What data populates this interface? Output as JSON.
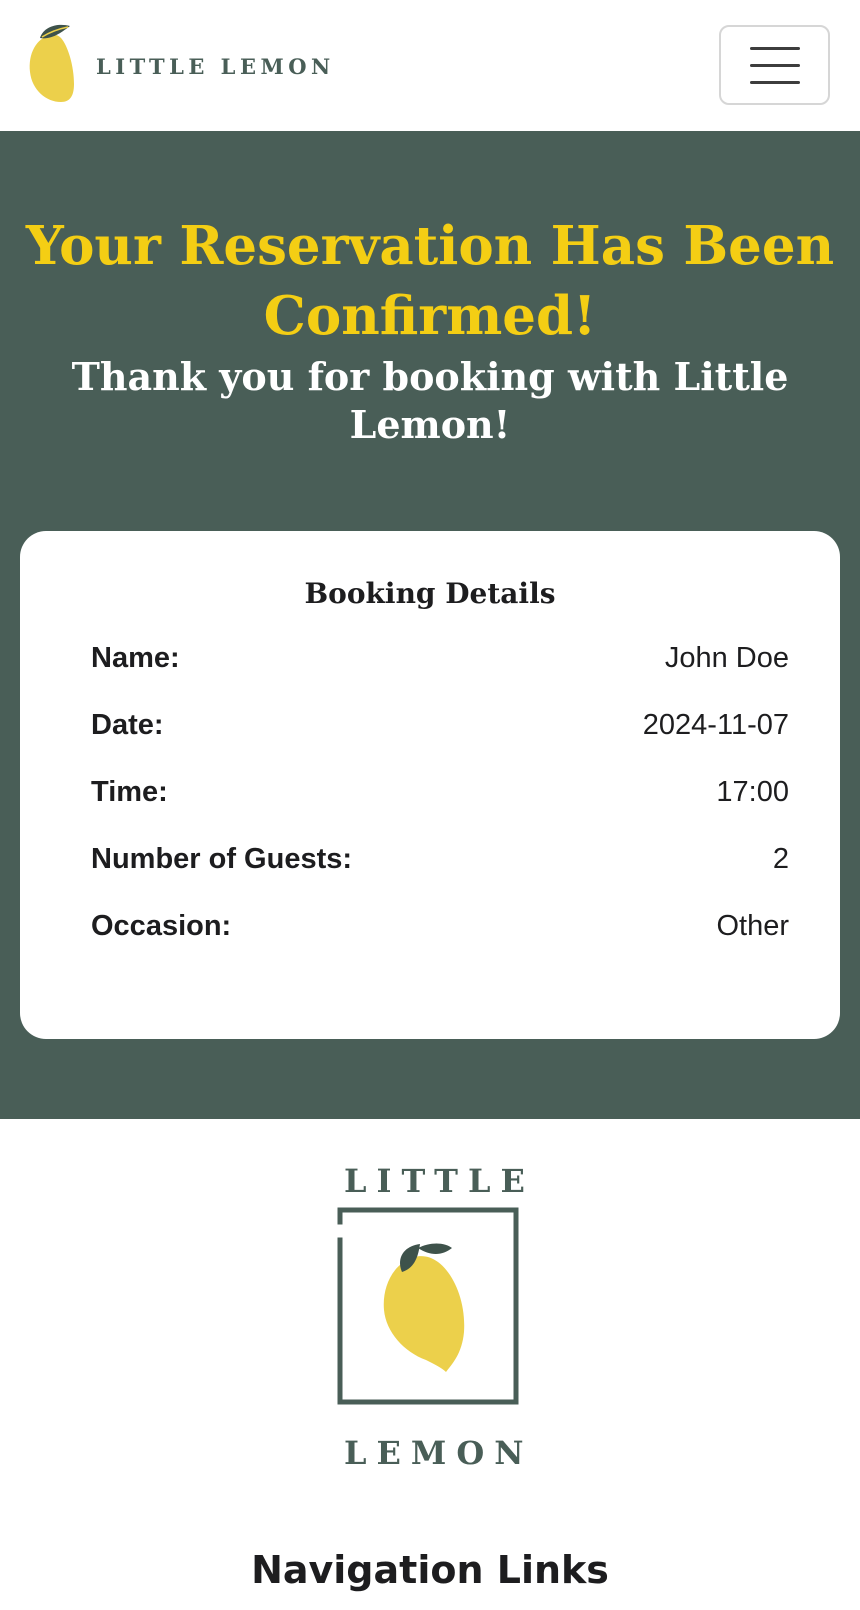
{
  "header": {
    "logo_text": "LITTLE LEMON",
    "logo_icon": "lemon-icon",
    "menu_icon": "hamburger-menu-icon"
  },
  "hero": {
    "title": "Your Reservation Has Been Confirmed!",
    "subtitle": "Thank you for booking with Little Lemon!"
  },
  "booking": {
    "title": "Booking Details",
    "rows": [
      {
        "label": "Name:",
        "value": "John Doe"
      },
      {
        "label": "Date:",
        "value": "2024-11-07"
      },
      {
        "label": "Time:",
        "value": "17:00"
      },
      {
        "label": "Number of Guests:",
        "value": "2"
      },
      {
        "label": "Occasion:",
        "value": "Other"
      }
    ]
  },
  "footer": {
    "logo_top": "LITTLE",
    "logo_bottom": "LEMON",
    "nav_title": "Navigation Links"
  },
  "colors": {
    "brand_green": "#495e57",
    "brand_yellow": "#f4ce14",
    "lemon_yellow": "#ecd04b",
    "leaf_green": "#3e524b"
  }
}
